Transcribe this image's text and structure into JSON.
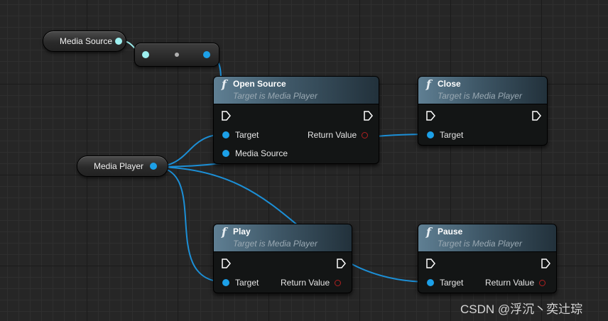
{
  "variables": {
    "media_source": {
      "label": "Media Source"
    },
    "media_player": {
      "label": "Media  Player"
    }
  },
  "functions": {
    "open_source": {
      "title": "Open Source",
      "subtitle": "Target is Media Player",
      "pins": {
        "target": "Target",
        "media_source": "Media Source",
        "return_value": "Return Value"
      }
    },
    "close": {
      "title": "Close",
      "subtitle": "Target is Media Player",
      "pins": {
        "target": "Target"
      }
    },
    "play": {
      "title": "Play",
      "subtitle": "Target is Media Player",
      "pins": {
        "target": "Target",
        "return_value": "Return Value"
      }
    },
    "pause": {
      "title": "Pause",
      "subtitle": "Target is Media Player",
      "pins": {
        "target": "Target",
        "return_value": "Return Value"
      }
    }
  },
  "icons": {
    "function": "f",
    "exec": "exec-arrow-icon",
    "object_pin": "object-pin-icon",
    "return_pin": "bool-pin-icon"
  },
  "colors": {
    "object_pin": "#1ca0e8",
    "media_source_pin": "#9ef0f0",
    "bool_pin": "#b02020",
    "wire": "#1c8fd6"
  },
  "watermark": "CSDN @浮沉丶奕辻琮"
}
